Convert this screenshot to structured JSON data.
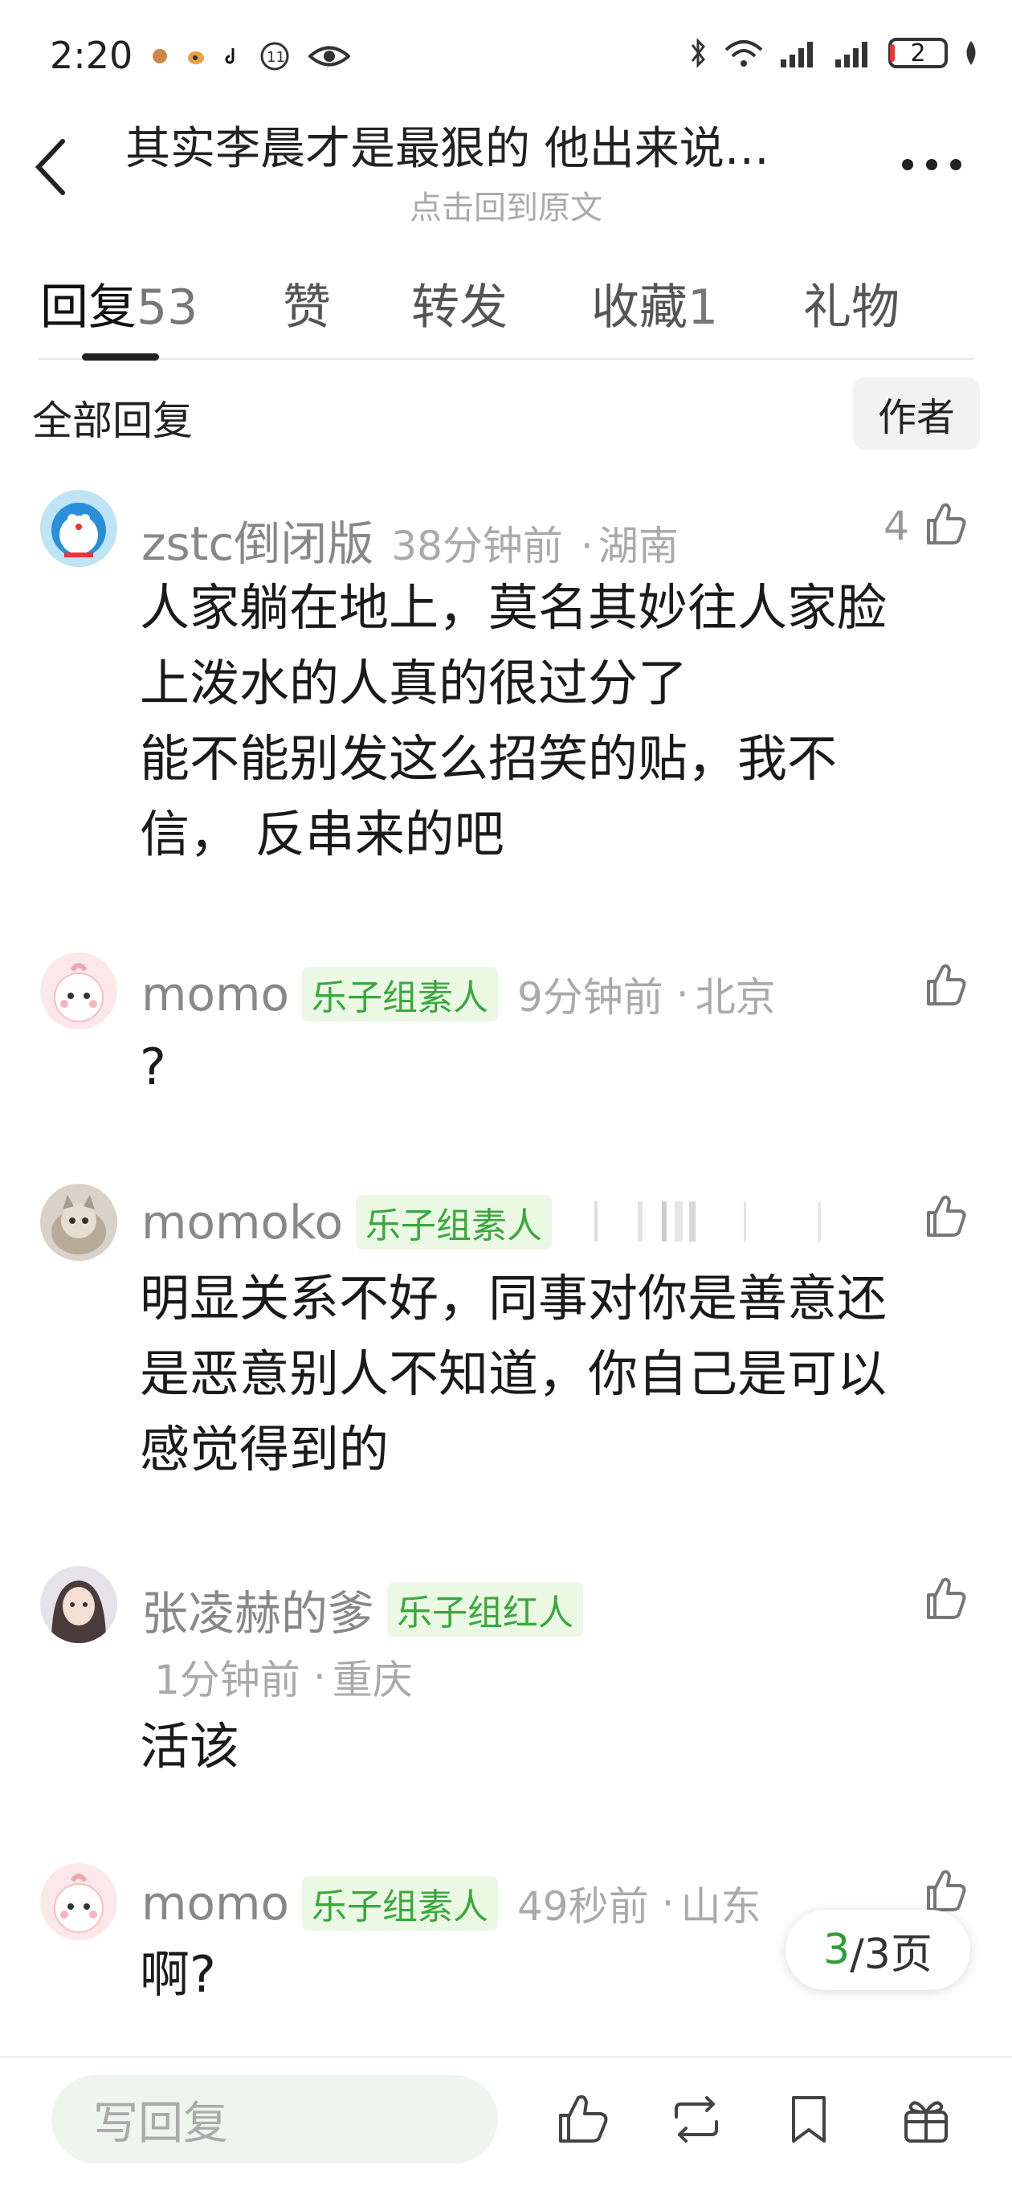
{
  "status_bar": {
    "time": "2:20",
    "battery": "2"
  },
  "header": {
    "title": "其实李晨才是最狠的 他出来说…",
    "subtitle": "点击回到原文"
  },
  "tabs": [
    {
      "label": "回复",
      "count": "53"
    },
    {
      "label": "赞",
      "count": ""
    },
    {
      "label": "转发",
      "count": ""
    },
    {
      "label": "收藏",
      "count": "1"
    },
    {
      "label": "礼物",
      "count": ""
    }
  ],
  "filter": {
    "all_label": "全部回复",
    "author_label": "作者"
  },
  "comments": [
    {
      "user": "zstc倒闭版",
      "badge": "",
      "time": "38分钟前",
      "location": "湖南",
      "likes": "4",
      "lines": [
        "人家躺在地上，莫名其妙往人家脸",
        "上泼水的人真的很过分了",
        "能不能别发这么招笑的贴，我不",
        "信， 反串来的吧"
      ]
    },
    {
      "user": "momo",
      "badge": "乐子组素人",
      "time": "9分钟前",
      "location": "北京",
      "likes": "",
      "lines": [
        "?"
      ]
    },
    {
      "user": "momoko",
      "badge": "乐子组素人",
      "time": "",
      "location": "",
      "likes": "",
      "lines": [
        "明显关系不好，同事对你是善意还",
        "是恶意别人不知道，你自己是可以",
        "感觉得到的"
      ]
    },
    {
      "user": "张凌赫的爹",
      "badge": "乐子组红人",
      "time": "1分钟前",
      "location": "重庆",
      "likes": "",
      "lines": [
        "活该"
      ]
    },
    {
      "user": "momo",
      "badge": "乐子组素人",
      "time": "49秒前",
      "location": "山东",
      "likes": "",
      "lines": [
        "啊?"
      ]
    }
  ],
  "pager": {
    "current": "3",
    "total": "/3页"
  },
  "bottom": {
    "reply_placeholder": "写回复"
  },
  "colors": {
    "badge_green": "#39a83d",
    "badge_bg": "#eaf8e4",
    "accent_green": "#2e9e3a"
  }
}
